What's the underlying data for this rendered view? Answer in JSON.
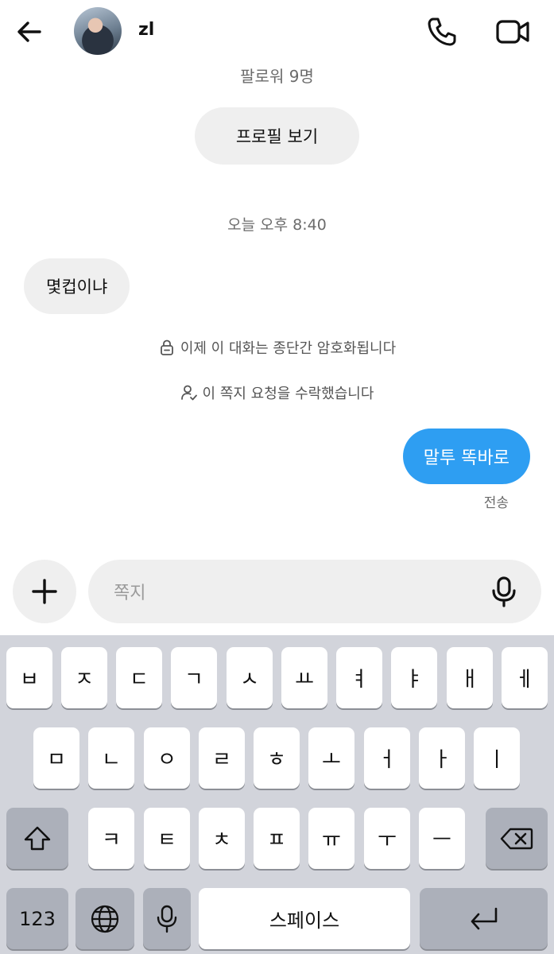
{
  "header": {
    "contact_name": "zl",
    "followers": "팔로워 9명",
    "profile_button": "프로필 보기"
  },
  "conversation": {
    "timestamp": "오늘 오후 8:40",
    "incoming_message": "몇컵이냐",
    "encryption_notice": "이제 이 대화는 종단간 암호화됩니다",
    "request_notice": "이 쪽지 요청을 수락했습니다",
    "outgoing_message": "말투 똑바로",
    "sent_status": "전송"
  },
  "composer": {
    "placeholder": "쪽지"
  },
  "keyboard": {
    "row1": [
      "ㅂ",
      "ㅈ",
      "ㄷ",
      "ㄱ",
      "ㅅ",
      "ㅛ",
      "ㅕ",
      "ㅑ",
      "ㅐ",
      "ㅔ"
    ],
    "row2": [
      "ㅁ",
      "ㄴ",
      "ㅇ",
      "ㄹ",
      "ㅎ",
      "ㅗ",
      "ㅓ",
      "ㅏ",
      "ㅣ"
    ],
    "row3": [
      "ㅋ",
      "ㅌ",
      "ㅊ",
      "ㅍ",
      "ㅠ",
      "ㅜ",
      "ㅡ"
    ],
    "numbers_key": "123",
    "space_key": "스페이스"
  },
  "colors": {
    "outgoing_bubble": "#2e9ef2",
    "incoming_bubble": "#efefef",
    "keyboard_bg": "#d2d4db"
  }
}
